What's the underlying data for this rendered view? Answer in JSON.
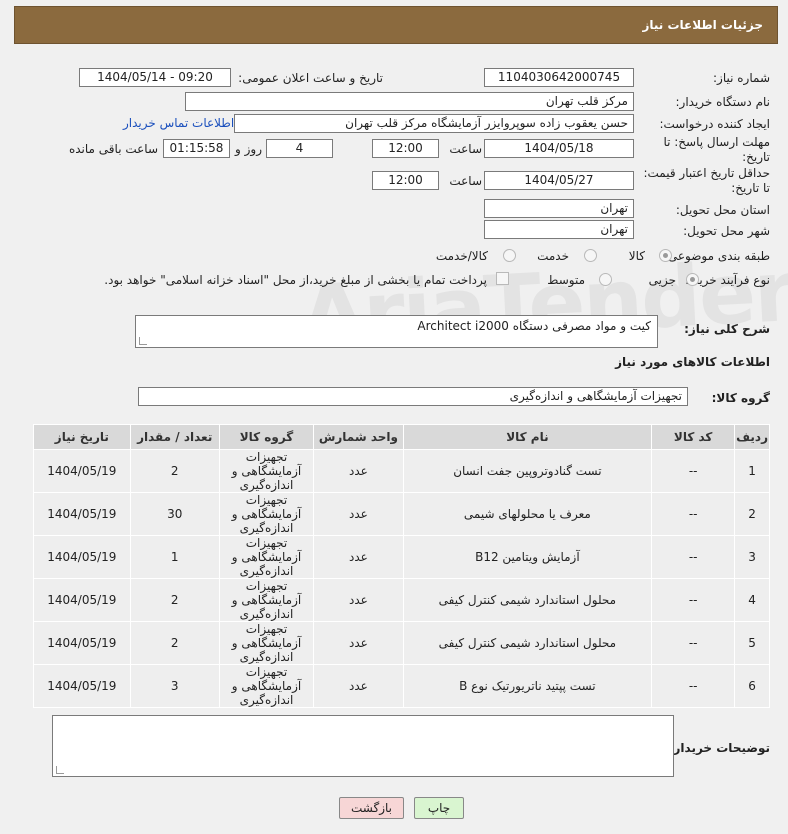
{
  "header": {
    "title": "جزئیات اطلاعات نیاز"
  },
  "watermark": "AriaTender.neT",
  "need_number": {
    "label": "شماره نیاز:",
    "value": "1104030642000745"
  },
  "announce": {
    "label": "تاریخ و ساعت اعلان عمومی:",
    "value": "1404/05/14 - 09:20"
  },
  "buyer_org": {
    "label": "نام دستگاه خریدار:",
    "value": "مرکز قلب تهران"
  },
  "requester": {
    "label": "ایجاد کننده درخواست:",
    "value": "حسن یعقوب زاده سوپروایزر آزمایشگاه مرکز قلب تهران",
    "contact_link": "اطلاعات تماس خریدار"
  },
  "deadline": {
    "label": "مهلت ارسال پاسخ: تا تاریخ:",
    "date": "1404/05/18",
    "time_label": "ساعت",
    "time": "12:00",
    "days": "4",
    "days_label": "روز و",
    "remaining": "01:15:58",
    "remaining_label": "ساعت باقی مانده"
  },
  "validity": {
    "label": "حداقل تاریخ اعتبار قیمت: تا تاریخ:",
    "date": "1404/05/27",
    "time_label": "ساعت",
    "time": "12:00"
  },
  "province": {
    "label": "استان محل تحویل:",
    "value": "تهران"
  },
  "city": {
    "label": "شهر محل تحویل:",
    "value": "تهران"
  },
  "category": {
    "label": "طبقه بندی موضوعی:",
    "options": [
      "کالا",
      "خدمت",
      "کالا/خدمت"
    ],
    "selected": 0
  },
  "process": {
    "label": "نوع فرآیند خرید :",
    "options": [
      "جزیی",
      "متوسط"
    ],
    "selected": 0,
    "payment_note": "پرداخت تمام یا بخشی از مبلغ خرید،از محل \"اسناد خزانه اسلامی\" خواهد بود."
  },
  "description": {
    "label": "شرح کلی نیاز:",
    "value": "کیت و مواد مصرفی دستگاه Architect i2000"
  },
  "goods_info": {
    "title": "اطلاعات کالاهای مورد نیاز"
  },
  "goods_group": {
    "label": "گروه کالا:",
    "value": "تجهیزات آزمایشگاهی و اندازه‌گیری"
  },
  "table": {
    "headers": [
      "ردیف",
      "کد کالا",
      "نام کالا",
      "واحد شمارش",
      "گروه کالا",
      "تعداد / مقدار",
      "تاریخ نیاز"
    ],
    "rows": [
      [
        "1",
        "--",
        "تست گنادوتروپین جفت انسان",
        "عدد",
        "تجهیزات آزمایشگاهی و اندازه‌گیری",
        "2",
        "1404/05/19"
      ],
      [
        "2",
        "--",
        "معرف یا محلولهای شیمی",
        "عدد",
        "تجهیزات آزمایشگاهی و اندازه‌گیری",
        "30",
        "1404/05/19"
      ],
      [
        "3",
        "--",
        "آزمایش ویتامین B12",
        "عدد",
        "تجهیزات آزمایشگاهی و اندازه‌گیری",
        "1",
        "1404/05/19"
      ],
      [
        "4",
        "--",
        "محلول استاندارد شیمی کنترل کیفی",
        "عدد",
        "تجهیزات آزمایشگاهی و اندازه‌گیری",
        "2",
        "1404/05/19"
      ],
      [
        "5",
        "--",
        "محلول استاندارد شیمی کنترل کیفی",
        "عدد",
        "تجهیزات آزمایشگاهی و اندازه‌گیری",
        "2",
        "1404/05/19"
      ],
      [
        "6",
        "--",
        "تست پپتید ناتریورتیک نوع B",
        "عدد",
        "تجهیزات آزمایشگاهی و اندازه‌گیری",
        "3",
        "1404/05/19"
      ]
    ]
  },
  "buyer_notes": {
    "label": "توضیحات خریدار:",
    "value": ""
  },
  "buttons": {
    "print": "چاپ",
    "back": "بازگشت"
  },
  "colors": {
    "header_bg": "#8b6a3e",
    "link": "#1a4fbd",
    "print_btn": "#d9f5d0",
    "back_btn": "#f7d6d6"
  }
}
